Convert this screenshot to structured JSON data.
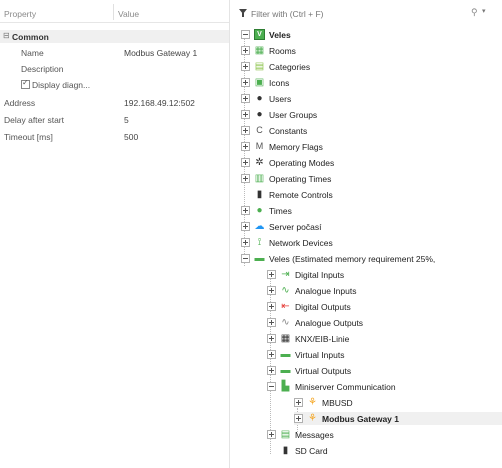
{
  "props": {
    "header_property": "Property",
    "header_value": "Value",
    "group_label": "Common",
    "rows": [
      {
        "name": "Name",
        "value": "Modbus Gateway 1"
      },
      {
        "name": "Description",
        "value": ""
      },
      {
        "name": "Display diagn...",
        "value": "",
        "checkbox": true
      },
      {
        "name": "Address",
        "value": "192.168.49.12:502"
      },
      {
        "name": "Delay after start",
        "value": "5"
      },
      {
        "name": "Timeout [ms]",
        "value": "500"
      }
    ]
  },
  "tree": {
    "filter_placeholder": "Filter with (Ctrl + F)",
    "root_label": "Veles",
    "items": [
      {
        "label": "Rooms",
        "icon": "rooms-icon",
        "color": "#4caf50"
      },
      {
        "label": "Categories",
        "icon": "categories-icon",
        "color": "#8bc34a"
      },
      {
        "label": "Icons",
        "icon": "icons-icon",
        "color": "#4caf50"
      },
      {
        "label": "Users",
        "icon": "user-icon",
        "color": "#333333"
      },
      {
        "label": "User Groups",
        "icon": "user-group-icon",
        "color": "#333333"
      },
      {
        "label": "Constants",
        "icon": "constant-icon",
        "color": "#555555"
      },
      {
        "label": "Memory Flags",
        "icon": "memory-flag-icon",
        "color": "#555555"
      },
      {
        "label": "Operating Modes",
        "icon": "operating-mode-icon",
        "color": "#333333"
      },
      {
        "label": "Operating Times",
        "icon": "operating-time-icon",
        "color": "#4caf50"
      },
      {
        "label": "Remote Controls",
        "icon": "remote-control-icon",
        "color": "#333333"
      },
      {
        "label": "Times",
        "icon": "timer-icon",
        "color": "#4caf50"
      },
      {
        "label": "Server počasí",
        "icon": "weather-icon",
        "color": "#2196f3"
      },
      {
        "label": "Network Devices",
        "icon": "network-icon",
        "color": "#4caf50"
      },
      {
        "label": "Veles (Estimated memory requirement 25%,",
        "icon": "miniserver-icon",
        "color": "#4caf50"
      },
      {
        "label": "Digital Inputs",
        "icon": "digital-input-icon",
        "color": "#4caf50"
      },
      {
        "label": "Analogue Inputs",
        "icon": "analogue-input-icon",
        "color": "#4caf50"
      },
      {
        "label": "Digital Outputs",
        "icon": "digital-output-icon",
        "color": "#e53935"
      },
      {
        "label": "Analogue Outputs",
        "icon": "analogue-output-icon",
        "color": "#888888"
      },
      {
        "label": "KNX/EIB-Linie",
        "icon": "knx-icon",
        "color": "#333333"
      },
      {
        "label": "Virtual Inputs",
        "icon": "virtual-input-icon",
        "color": "#4caf50"
      },
      {
        "label": "Virtual Outputs",
        "icon": "virtual-output-icon",
        "color": "#4caf50"
      },
      {
        "label": "Miniserver Communication",
        "icon": "miniserver-communication-icon",
        "color": "#4caf50"
      },
      {
        "label": "MBUSD",
        "icon": "mbusd-icon",
        "color": "#f5a623"
      },
      {
        "label": "Modbus Gateway 1",
        "icon": "modbus-icon",
        "color": "#f5a623"
      },
      {
        "label": "Messages",
        "icon": "messages-icon",
        "color": "#4caf50"
      },
      {
        "label": "SD Card",
        "icon": "sd-card-icon",
        "color": "#333333"
      }
    ]
  }
}
